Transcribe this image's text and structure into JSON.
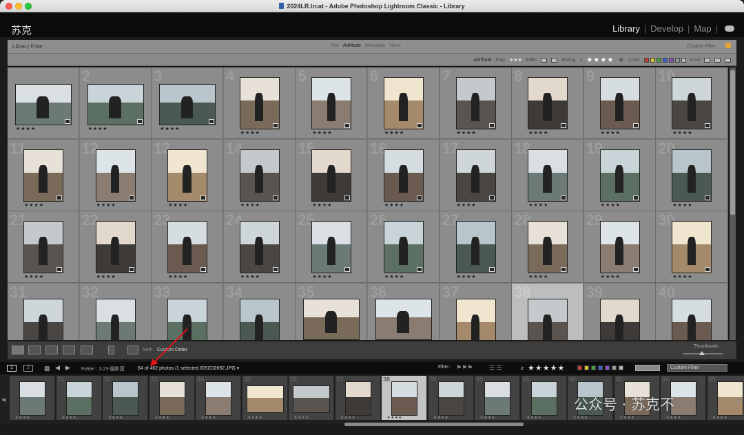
{
  "window": {
    "title": "2024LR.lrcat - Adobe Photoshop Lightroom Classic - Library"
  },
  "identity_plate": "苏克",
  "modules": {
    "library": "Library",
    "develop": "Develop",
    "map": "Map"
  },
  "library_filter": {
    "label": "Library Filter :",
    "tabs": [
      "Text",
      "Attribute",
      "Metadata",
      "None"
    ],
    "active_tab": "Attribute",
    "preset": "Custom Filter"
  },
  "attribute_bar": {
    "attribute": "Attribute",
    "flag": "Flag",
    "edits": "Edits",
    "rating": "Rating",
    "rating_op": "≥",
    "rating_stars": "★★★★",
    "rating_empty": "★",
    "color": "Color",
    "kind": "Kind",
    "color_swatches": [
      "#c23b3b",
      "#d6c232",
      "#4a9d3f",
      "#3f63c9",
      "#8c4fb5",
      "#999999",
      "#b5b5b5"
    ]
  },
  "grid": {
    "rows": [
      {
        "cells": [
          {
            "num": "",
            "stars": "★★★★"
          },
          {
            "num": "2",
            "stars": "★★★★"
          },
          {
            "num": "3",
            "stars": "★★★★"
          },
          {
            "num": "4",
            "stars": "★★★★"
          },
          {
            "num": "5",
            "stars": "★★★★"
          },
          {
            "num": "6",
            "stars": "★★★★"
          },
          {
            "num": "7",
            "stars": "★★★★"
          },
          {
            "num": "8",
            "stars": "★★★★"
          },
          {
            "num": "9",
            "stars": "★★★★"
          },
          {
            "num": "10",
            "stars": "★★★★"
          }
        ]
      },
      {
        "cells": [
          {
            "num": "11",
            "stars": "★★★★"
          },
          {
            "num": "12",
            "stars": "★★★★"
          },
          {
            "num": "13",
            "stars": "★★★★"
          },
          {
            "num": "14",
            "stars": "★★★★"
          },
          {
            "num": "15",
            "stars": "★★★★"
          },
          {
            "num": "16",
            "stars": "★★★★"
          },
          {
            "num": "17",
            "stars": "★★★★"
          },
          {
            "num": "18",
            "stars": "★★★★"
          },
          {
            "num": "19",
            "stars": "★★★★"
          },
          {
            "num": "20",
            "stars": "★★★★"
          }
        ]
      },
      {
        "cells": [
          {
            "num": "21",
            "stars": "★★★★"
          },
          {
            "num": "22",
            "stars": "★★★★"
          },
          {
            "num": "23",
            "stars": "★★★★"
          },
          {
            "num": "24",
            "stars": "★★★★"
          },
          {
            "num": "25",
            "stars": "★★★★"
          },
          {
            "num": "26",
            "stars": "★★★★"
          },
          {
            "num": "27",
            "stars": "★★★★"
          },
          {
            "num": "28",
            "stars": "★★★★"
          },
          {
            "num": "29",
            "stars": "★★★★"
          },
          {
            "num": "30",
            "stars": "★★★★"
          }
        ]
      },
      {
        "cells": [
          {
            "num": "31",
            "stars": ""
          },
          {
            "num": "32",
            "stars": ""
          },
          {
            "num": "33",
            "stars": ""
          },
          {
            "num": "34",
            "stars": ""
          },
          {
            "num": "35",
            "stars": ""
          },
          {
            "num": "36",
            "stars": ""
          },
          {
            "num": "37",
            "stars": ""
          },
          {
            "num": "38",
            "stars": ""
          },
          {
            "num": "39",
            "stars": ""
          },
          {
            "num": "40",
            "stars": ""
          }
        ]
      }
    ]
  },
  "toolbar": {
    "sort_label": "Sort:",
    "sort_value": "Custom Order",
    "thumbnails_label": "Thumbnails"
  },
  "filmstrip_header": {
    "page1": "1",
    "page2": "2",
    "path": "Folder : 3.23-摄影团",
    "count": "64 of 462 photos /1 selected /DSC02692.JPG ▾",
    "filter_label": "Filter :",
    "rating_op": "≥",
    "stars": "★★★★★",
    "custom_filter": "Custom Filter"
  },
  "filmstrip": {
    "cells": [
      {
        "num": "",
        "stars": "★★★★"
      },
      {
        "num": "31",
        "stars": "★★★★"
      },
      {
        "num": "32",
        "stars": "★★★★"
      },
      {
        "num": "33",
        "stars": "★★★★"
      },
      {
        "num": "34",
        "stars": "★★★★"
      },
      {
        "num": "35",
        "stars": "★★★★"
      },
      {
        "num": "36",
        "stars": "★★★★"
      },
      {
        "num": "37",
        "stars": "★★★★"
      },
      {
        "num": "38",
        "stars": "★★★★"
      },
      {
        "num": "39",
        "stars": "★★★★"
      },
      {
        "num": "40",
        "stars": "★★★★"
      },
      {
        "num": "41",
        "stars": "★★★★"
      },
      {
        "num": "42",
        "stars": "★★★★"
      },
      {
        "num": "43",
        "stars": "★★★★"
      },
      {
        "num": "44",
        "stars": "★★★★"
      },
      {
        "num": "45",
        "stars": "★★★★"
      }
    ],
    "selected_index": 8
  },
  "watermark": "公众号 · 苏克不",
  "colors": {
    "accent": "#e8e8e8",
    "annotation_arrow": "#e01818",
    "lock": "#e1a73b"
  }
}
